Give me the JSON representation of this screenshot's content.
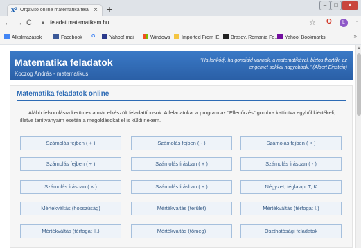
{
  "browser": {
    "tab_title": "Órgavító online matematika felad",
    "tab_favicon": "x²",
    "new_tab": "+",
    "url": "feladat.matematikam.hu",
    "avatar_letter": "L"
  },
  "bookmarks": [
    {
      "label": "Alkalmazások",
      "icon_color": "#4285f4"
    },
    {
      "label": "Facebook",
      "icon_color": "#3b5998"
    },
    {
      "label": "",
      "icon_color": "#4285f4",
      "glyph": "G"
    },
    {
      "label": "Yahoo! mail",
      "icon_color": "#2b3a8c"
    },
    {
      "label": "Windows",
      "icon_color": "#f25022"
    },
    {
      "label": "Imported From IE",
      "icon_color": "#f4c542"
    },
    {
      "label": "Brasov, Romania Fo...",
      "icon_color": "#222222"
    },
    {
      "label": "Yahoo! Bookmarks",
      "icon_color": "#720e9e"
    }
  ],
  "site": {
    "title": "Matematika feladatok",
    "subtitle": "Koczog András - matematikus",
    "quote": "\"Ha lankódj, ha gondjaid vannak, a matematikával, biztos tharták, az engemet sokkal nagyobbak.\" (Albert Einstein)"
  },
  "content": {
    "section_title": "Matematika feladatok online",
    "intro": "Alább felsorolásra kerülnek a már elkészült feladattípusok. A feladatokat a program az \"Ellenőrzés\" gombra kattintva egyből kiértékeli, illetve tanítványaim esetén a megoldásokat el is küldi nekem.",
    "buttons": [
      "Számolás fejben ( + )",
      "Számolás fejben ( - )",
      "Számolás fejben ( × )",
      "Számolás fejben ( ÷ )",
      "Számolás írásban ( + )",
      "Számolás írásban ( - )",
      "Számolás írásban ( × )",
      "Számolás írásban ( ÷ )",
      "Négyzet, téglalap, T, K",
      "Mértékváltás (hosszúság)",
      "Mértékváltás (terület)",
      "Mértékváltás (térfogat I.)",
      "Mértékváltás (térfogat II.)",
      "Mértékváltás (tömeg)",
      "Oszthatósági feladatok"
    ]
  }
}
